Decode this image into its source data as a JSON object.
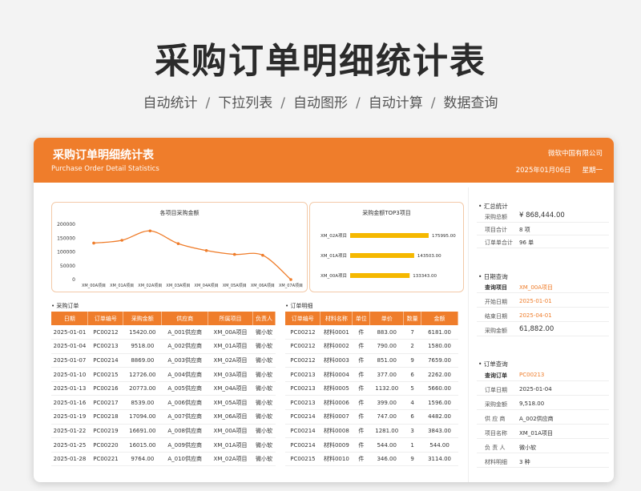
{
  "hero": {
    "title": "采购订单明细统计表",
    "features": [
      "自动统计",
      "下拉列表",
      "自动图形",
      "自动计算",
      "数据查询"
    ],
    "separator": "/"
  },
  "header": {
    "title": "采购订单明细统计表",
    "subtitle": "Purchase Order Detail Statistics",
    "company": "微软中国有限公司",
    "date": "2025年01月06日",
    "weekday": "星期一"
  },
  "colors": {
    "accent": "#ef7d2b",
    "bar": "#f5b800"
  },
  "chart_data": [
    {
      "type": "line",
      "title": "各项目采购金额",
      "categories": [
        "XM_00A项目",
        "XM_01A项目",
        "XM_02A项目",
        "XM_03A项目",
        "XM_04A项目",
        "XM_05A项目",
        "XM_06A项目",
        "XM_07A项目"
      ],
      "values": [
        132000,
        142000,
        176000,
        130000,
        105000,
        91000,
        88000,
        0
      ],
      "yticks": [
        "200000",
        "150000",
        "100000",
        "50000",
        "0"
      ],
      "ylim": [
        0,
        200000
      ]
    },
    {
      "type": "bar",
      "orientation": "horizontal",
      "title": "采购金额TOP3项目",
      "categories": [
        "XM_02A项目",
        "XM_01A项目",
        "XM_00A项目"
      ],
      "values": [
        175995,
        143503,
        133343
      ],
      "labels": [
        "175995.00",
        "143503.00",
        "133343.00"
      ]
    }
  ],
  "orders": {
    "label": "• 采购订单",
    "columns": [
      "日期",
      "订单编号",
      "采购金额",
      "供应商",
      "所属项目",
      "负责人"
    ],
    "rows": [
      [
        "2025-01-01",
        "PC00212",
        "15420.00",
        "A_001供应商",
        "XM_00A项目",
        "微小软"
      ],
      [
        "2025-01-04",
        "PC00213",
        "9518.00",
        "A_002供应商",
        "XM_01A项目",
        "微小软"
      ],
      [
        "2025-01-07",
        "PC00214",
        "8869.00",
        "A_003供应商",
        "XM_02A项目",
        "微小软"
      ],
      [
        "2025-01-10",
        "PC00215",
        "12726.00",
        "A_004供应商",
        "XM_03A项目",
        "微小软"
      ],
      [
        "2025-01-13",
        "PC00216",
        "20773.00",
        "A_005供应商",
        "XM_04A项目",
        "微小软"
      ],
      [
        "2025-01-16",
        "PC00217",
        "8539.00",
        "A_006供应商",
        "XM_05A项目",
        "微小软"
      ],
      [
        "2025-01-19",
        "PC00218",
        "17094.00",
        "A_007供应商",
        "XM_06A项目",
        "微小软"
      ],
      [
        "2025-01-22",
        "PC00219",
        "16691.00",
        "A_008供应商",
        "XM_00A项目",
        "微小软"
      ],
      [
        "2025-01-25",
        "PC00220",
        "16015.00",
        "A_009供应商",
        "XM_01A项目",
        "微小软"
      ],
      [
        "2025-01-28",
        "PC00221",
        "9764.00",
        "A_010供应商",
        "XM_02A项目",
        "微小软"
      ]
    ]
  },
  "details": {
    "label": "• 订单明细",
    "columns": [
      "订单编号",
      "材料名称",
      "单位",
      "单价",
      "数量",
      "金额"
    ],
    "rows": [
      [
        "PC00212",
        "材料0001",
        "件",
        "883.00",
        "7",
        "6181.00"
      ],
      [
        "PC00212",
        "材料0002",
        "件",
        "790.00",
        "2",
        "1580.00"
      ],
      [
        "PC00212",
        "材料0003",
        "件",
        "851.00",
        "9",
        "7659.00"
      ],
      [
        "PC00213",
        "材料0004",
        "件",
        "377.00",
        "6",
        "2262.00"
      ],
      [
        "PC00213",
        "材料0005",
        "件",
        "1132.00",
        "5",
        "5660.00"
      ],
      [
        "PC00213",
        "材料0006",
        "件",
        "399.00",
        "4",
        "1596.00"
      ],
      [
        "PC00214",
        "材料0007",
        "件",
        "747.00",
        "6",
        "4482.00"
      ],
      [
        "PC00214",
        "材料0008",
        "件",
        "1281.00",
        "3",
        "3843.00"
      ],
      [
        "PC00214",
        "材料0009",
        "件",
        "544.00",
        "1",
        "544.00"
      ],
      [
        "PC00215",
        "材料0010",
        "件",
        "346.00",
        "9",
        "3114.00"
      ]
    ]
  },
  "summary": {
    "label": "• 汇总统计",
    "items": [
      {
        "key": "采购总额",
        "value": "¥ 868,444.00"
      },
      {
        "key": "项目合计",
        "value": "8 项"
      },
      {
        "key": "订单单合计",
        "value": "96 单"
      }
    ]
  },
  "date_query": {
    "label": "• 日期查询",
    "items": [
      {
        "key": "查询项目",
        "value": "XM_00A项目"
      },
      {
        "key": "开始日期",
        "value": "2025-01-01"
      },
      {
        "key": "结束日期",
        "value": "2025-04-01"
      },
      {
        "key": "采购金额",
        "value": "61,882.00"
      }
    ]
  },
  "order_query": {
    "label": "• 订单查询",
    "items": [
      {
        "key": "查询订单",
        "value": "PC00213"
      },
      {
        "key": "订单日期",
        "value": "2025-01-04"
      },
      {
        "key": "采购金额",
        "value": "9,518.00"
      },
      {
        "key": "供 应 商",
        "value": "A_002供应商"
      },
      {
        "key": "项目名称",
        "value": "XM_01A项目"
      },
      {
        "key": "负 责 人",
        "value": "微小软"
      },
      {
        "key": "材料明细",
        "value": "3 种"
      }
    ]
  }
}
